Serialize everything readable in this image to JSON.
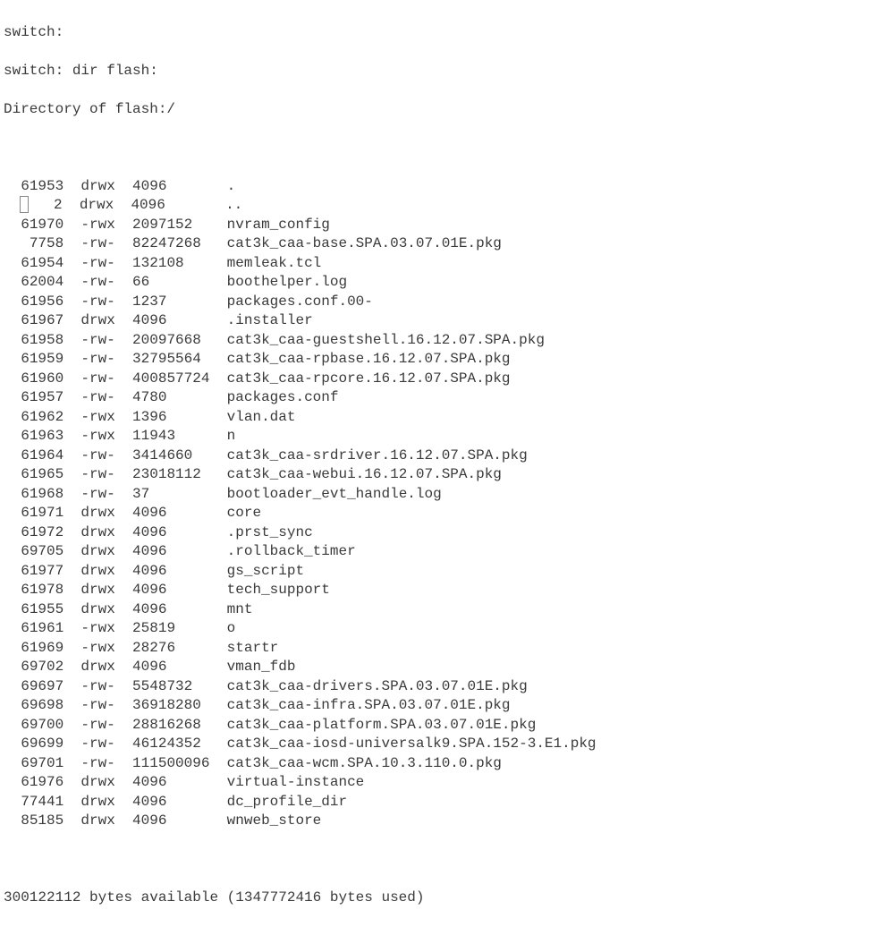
{
  "prompts": [
    "switch:",
    "switch: dir flash:",
    "Directory of flash:/"
  ],
  "blank_after_header": " ",
  "cursor_row_index": 1,
  "cursor_col_index": 1,
  "entries": [
    {
      "inode": "61953",
      "perms": "drwx",
      "size": "4096",
      "name": "."
    },
    {
      "inode": "2",
      "perms": "drwx",
      "size": "4096",
      "name": ".."
    },
    {
      "inode": "61970",
      "perms": "-rwx",
      "size": "2097152",
      "name": "nvram_config"
    },
    {
      "inode": "7758",
      "perms": "-rw-",
      "size": "82247268",
      "name": "cat3k_caa-base.SPA.03.07.01E.pkg"
    },
    {
      "inode": "61954",
      "perms": "-rw-",
      "size": "132108",
      "name": "memleak.tcl"
    },
    {
      "inode": "62004",
      "perms": "-rw-",
      "size": "66",
      "name": "boothelper.log"
    },
    {
      "inode": "61956",
      "perms": "-rw-",
      "size": "1237",
      "name": "packages.conf.00-"
    },
    {
      "inode": "61967",
      "perms": "drwx",
      "size": "4096",
      "name": ".installer"
    },
    {
      "inode": "61958",
      "perms": "-rw-",
      "size": "20097668",
      "name": "cat3k_caa-guestshell.16.12.07.SPA.pkg"
    },
    {
      "inode": "61959",
      "perms": "-rw-",
      "size": "32795564",
      "name": "cat3k_caa-rpbase.16.12.07.SPA.pkg"
    },
    {
      "inode": "61960",
      "perms": "-rw-",
      "size": "400857724",
      "name": "cat3k_caa-rpcore.16.12.07.SPA.pkg"
    },
    {
      "inode": "61957",
      "perms": "-rw-",
      "size": "4780",
      "name": "packages.conf"
    },
    {
      "inode": "61962",
      "perms": "-rwx",
      "size": "1396",
      "name": "vlan.dat"
    },
    {
      "inode": "61963",
      "perms": "-rwx",
      "size": "11943",
      "name": "n"
    },
    {
      "inode": "61964",
      "perms": "-rw-",
      "size": "3414660",
      "name": "cat3k_caa-srdriver.16.12.07.SPA.pkg"
    },
    {
      "inode": "61965",
      "perms": "-rw-",
      "size": "23018112",
      "name": "cat3k_caa-webui.16.12.07.SPA.pkg"
    },
    {
      "inode": "61968",
      "perms": "-rw-",
      "size": "37",
      "name": "bootloader_evt_handle.log"
    },
    {
      "inode": "61971",
      "perms": "drwx",
      "size": "4096",
      "name": "core"
    },
    {
      "inode": "61972",
      "perms": "drwx",
      "size": "4096",
      "name": ".prst_sync"
    },
    {
      "inode": "69705",
      "perms": "drwx",
      "size": "4096",
      "name": ".rollback_timer"
    },
    {
      "inode": "61977",
      "perms": "drwx",
      "size": "4096",
      "name": "gs_script"
    },
    {
      "inode": "61978",
      "perms": "drwx",
      "size": "4096",
      "name": "tech_support"
    },
    {
      "inode": "61955",
      "perms": "drwx",
      "size": "4096",
      "name": "mnt"
    },
    {
      "inode": "61961",
      "perms": "-rwx",
      "size": "25819",
      "name": "o"
    },
    {
      "inode": "61969",
      "perms": "-rwx",
      "size": "28276",
      "name": "startr"
    },
    {
      "inode": "69702",
      "perms": "drwx",
      "size": "4096",
      "name": "vman_fdb"
    },
    {
      "inode": "69697",
      "perms": "-rw-",
      "size": "5548732",
      "name": "cat3k_caa-drivers.SPA.03.07.01E.pkg"
    },
    {
      "inode": "69698",
      "perms": "-rw-",
      "size": "36918280",
      "name": "cat3k_caa-infra.SPA.03.07.01E.pkg"
    },
    {
      "inode": "69700",
      "perms": "-rw-",
      "size": "28816268",
      "name": "cat3k_caa-platform.SPA.03.07.01E.pkg"
    },
    {
      "inode": "69699",
      "perms": "-rw-",
      "size": "46124352",
      "name": "cat3k_caa-iosd-universalk9.SPA.152-3.E1.pkg"
    },
    {
      "inode": "69701",
      "perms": "-rw-",
      "size": "111500096",
      "name": "cat3k_caa-wcm.SPA.10.3.110.0.pkg"
    },
    {
      "inode": "61976",
      "perms": "drwx",
      "size": "4096",
      "name": "virtual-instance"
    },
    {
      "inode": "77441",
      "perms": "drwx",
      "size": "4096",
      "name": "dc_profile_dir"
    },
    {
      "inode": "85185",
      "perms": "drwx",
      "size": "4096",
      "name": "wnweb_store"
    }
  ],
  "blank_before_footer": " ",
  "footer": "300122112 bytes available (1347772416 bytes used)",
  "col_widths": {
    "inode": 6,
    "perms": 4,
    "size": 9
  },
  "indent": 1,
  "gap_after_inode": 2,
  "gap_after_perms": 2,
  "gap_after_size": 2
}
